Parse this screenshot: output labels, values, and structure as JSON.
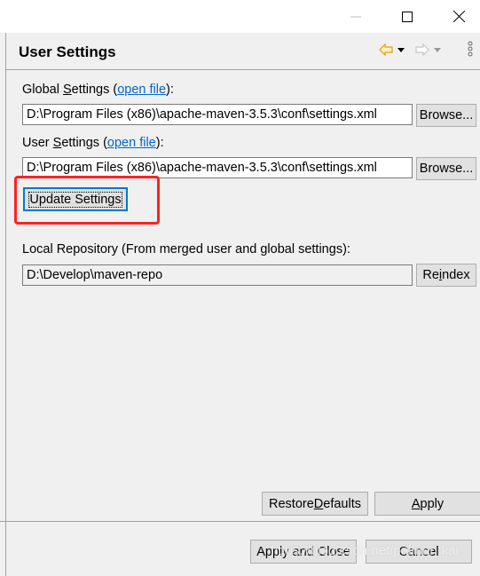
{
  "window": {
    "minimize_icon": "minimize-icon",
    "maximize_icon": "maximize-icon",
    "close_icon": "close-icon"
  },
  "header": {
    "title": "User Settings",
    "back_icon": "arrow-left-icon",
    "forward_icon": "arrow-right-icon",
    "menu_icon": "view-menu-icon",
    "back_color": "#e0a000"
  },
  "global": {
    "label_pre": "Global ",
    "label_mn": "S",
    "label_post": "ettings (",
    "link": "open file",
    "label_end": "):",
    "value": "D:\\Program Files (x86)\\apache-maven-3.5.3\\conf\\settings.xml",
    "browse": "Browse..."
  },
  "user": {
    "label_pre": "User ",
    "label_mn": "S",
    "label_post": "ettings (",
    "link": "open file",
    "label_end": "):",
    "value": "D:\\Program Files (x86)\\apache-maven-3.5.3\\conf\\settings.xml",
    "browse": "Browse..."
  },
  "update_button": "Update Settings",
  "local": {
    "label": "Local Repository (From merged user and global settings):",
    "value": "D:\\Develop\\maven-repo",
    "reindex_pre": "Re",
    "reindex_mn": "i",
    "reindex_post": "ndex"
  },
  "buttons": {
    "restore_pre": "Restore ",
    "restore_mn": "D",
    "restore_post": "efaults",
    "apply_mn": "A",
    "apply_post": "pply",
    "apply_close": "Apply and Close",
    "cancel": "Cancel"
  },
  "annotation_color": "#ff2222",
  "watermark": "https://blog.csdn.net/palmer_kai"
}
